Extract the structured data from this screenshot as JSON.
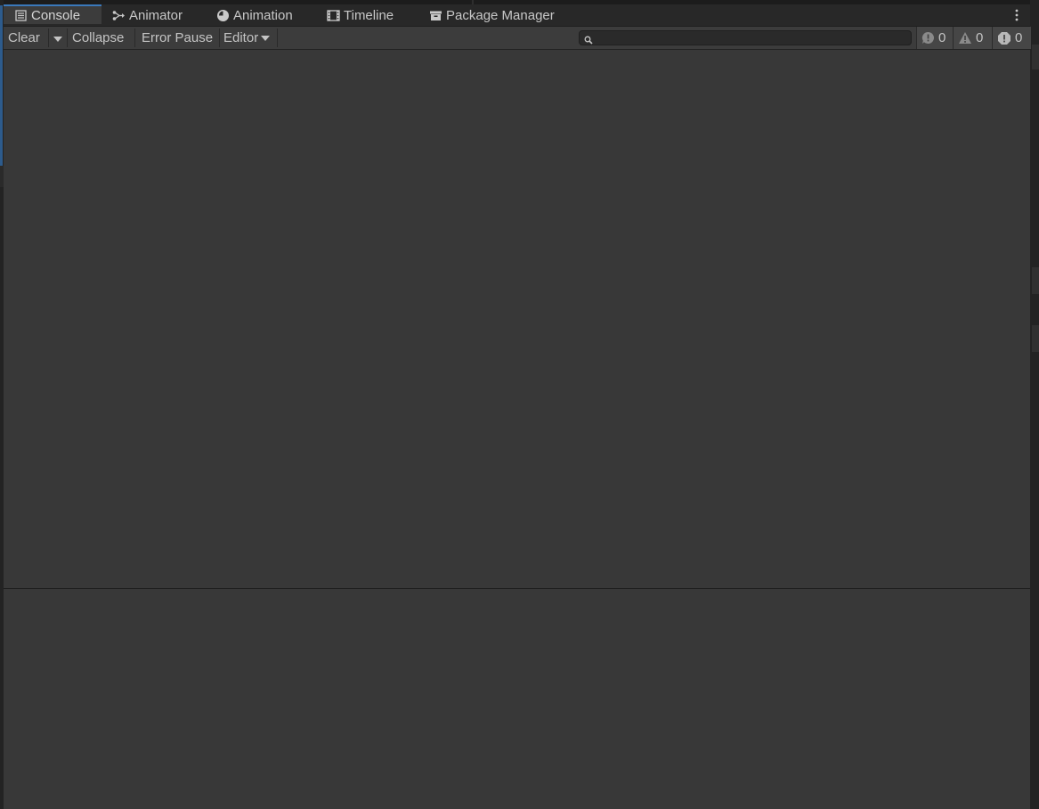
{
  "tabs": [
    {
      "label": "Console",
      "icon": "console-icon",
      "active": true
    },
    {
      "label": "Animator",
      "icon": "animator-icon",
      "active": false
    },
    {
      "label": "Animation",
      "icon": "animation-clock-icon",
      "active": false
    },
    {
      "label": "Timeline",
      "icon": "timeline-film-icon",
      "active": false
    },
    {
      "label": "Package Manager",
      "icon": "package-icon",
      "active": false
    }
  ],
  "toolbar": {
    "clear_label": "Clear",
    "collapse_label": "Collapse",
    "error_pause_label": "Error Pause",
    "editor_label": "Editor",
    "search": {
      "value": "",
      "placeholder": ""
    }
  },
  "counters": {
    "info": "0",
    "warning": "0",
    "error": "0"
  },
  "colors": {
    "accent": "#3a79bb",
    "panel": "#383838",
    "tabbar": "#282828"
  }
}
